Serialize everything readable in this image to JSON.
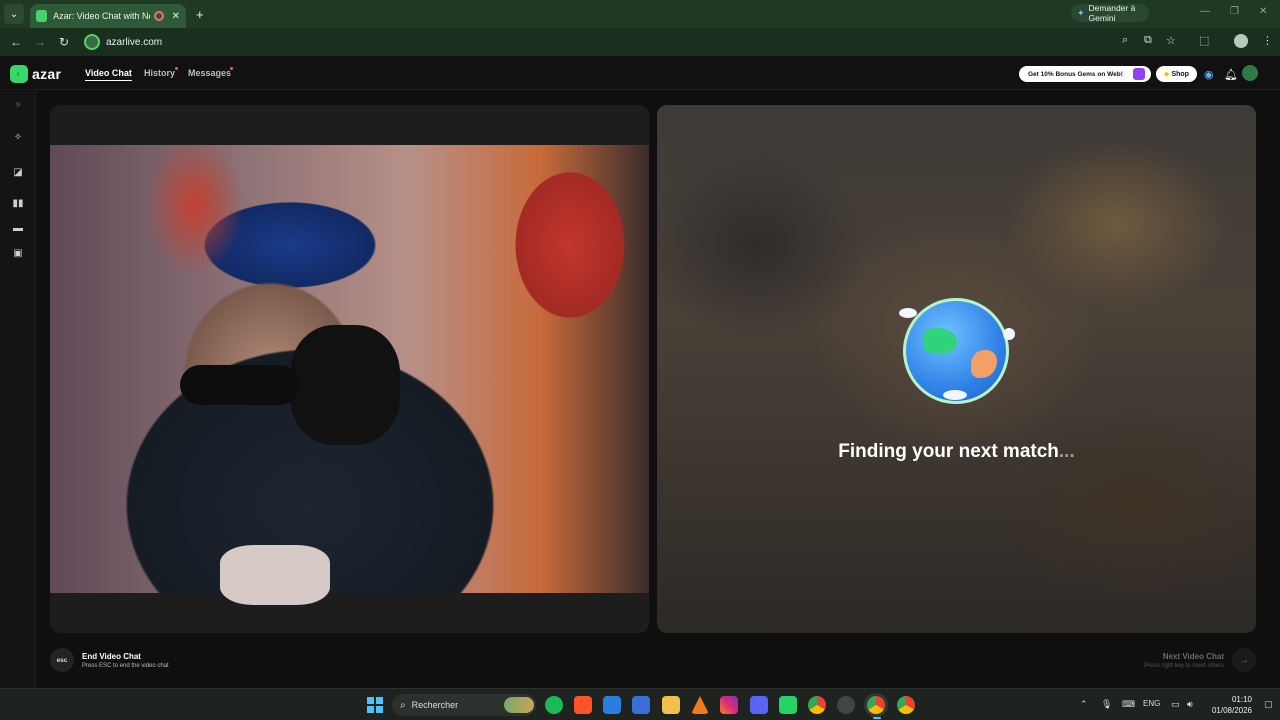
{
  "browser": {
    "tab_title": "Azar: Video Chat with New",
    "new_tab": "+",
    "gemini_label": "Demander à Gemini",
    "url": "azarlive.com"
  },
  "app": {
    "logo_text": "azar",
    "nav": {
      "video_chat": "Video Chat",
      "history": "History",
      "messages": "Messages"
    },
    "bonus_label": "Get 10% Bonus Gems on Web!",
    "shop_label": "Shop",
    "finding_text": "Finding your next match",
    "finding_dots": "...",
    "footer": {
      "esc_key": "esc",
      "end_title": "End Video Chat",
      "end_sub": "Press ESC to end the video chat",
      "next_title": "Next Video Chat",
      "next_sub": "Press right key to meet others"
    }
  },
  "taskbar": {
    "search_label": "Rechercher",
    "lang": "ENG",
    "time": "01:10",
    "date": "01/08/2026"
  },
  "icons": {
    "accent": "#39d66a",
    "brand_dark": "#1e3a24"
  }
}
